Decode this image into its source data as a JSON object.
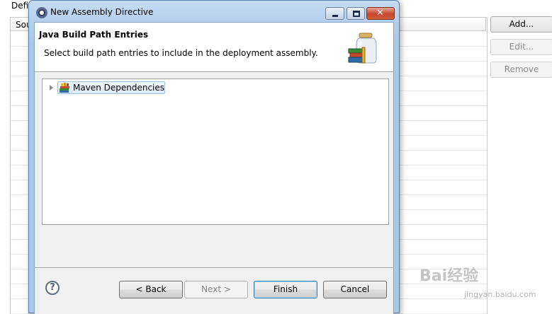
{
  "background": {
    "top_label": "Defi",
    "table_header": "Sou",
    "buttons": {
      "add": "Add...",
      "edit": "Edit...",
      "remove": "Remove"
    }
  },
  "dialog": {
    "title": "New Assembly Directive",
    "banner": {
      "title": "Java Build Path Entries",
      "description": "Select build path entries to include in the deployment assembly."
    },
    "tree": {
      "items": [
        {
          "label": "Maven Dependencies",
          "icon": "library-icon",
          "expanded": false,
          "selected": true
        }
      ]
    },
    "buttons": {
      "back": "< Back",
      "next": "Next >",
      "finish": "Finish",
      "cancel": "Cancel"
    },
    "help_glyph": "?"
  },
  "watermark": {
    "main": "Bai经验",
    "sub": "jingyan.baidu.com"
  },
  "colors": {
    "titlebar": "#b5d0ee",
    "close_button": "#c8452c",
    "selection": "#dce9f7"
  }
}
